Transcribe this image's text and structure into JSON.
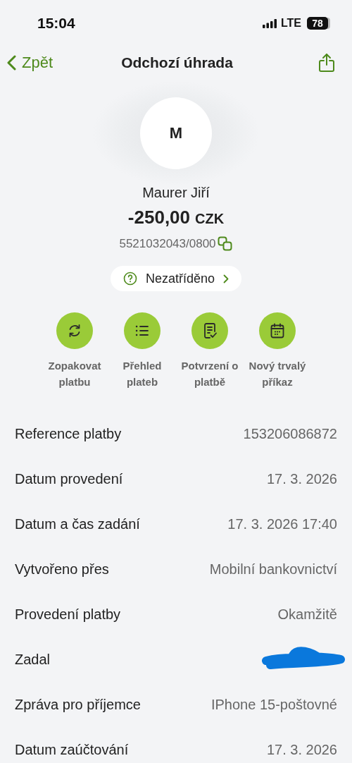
{
  "status_bar": {
    "time": "15:04",
    "network": "LTE",
    "battery": "78"
  },
  "nav": {
    "back": "Zpět",
    "title": "Odchozí úhrada"
  },
  "header": {
    "avatar": "M",
    "name": "Maurer Jiří",
    "amount": "-250,00",
    "currency": "CZK",
    "account": "5521032043/0800",
    "category": "Nezatříděno"
  },
  "actions": [
    {
      "kind": "repeat",
      "label": "Zopakovat platbu"
    },
    {
      "kind": "list",
      "label": "Přehled plateb"
    },
    {
      "kind": "document",
      "label": "Potvrzení o platbě"
    },
    {
      "kind": "calendar",
      "label": "Nový trvalý příkaz"
    }
  ],
  "details": [
    {
      "kind": "text",
      "label": "Reference platby",
      "value": "153206086872"
    },
    {
      "kind": "text",
      "label": "Datum provedení",
      "value": "17. 3. 2026"
    },
    {
      "kind": "text",
      "label": "Datum a čas zadání",
      "value": "17. 3. 2026 17:40"
    },
    {
      "kind": "text",
      "label": "Vytvořeno přes",
      "value": "Mobilní bankovnictví"
    },
    {
      "kind": "text",
      "label": "Provedení platby",
      "value": "Okamžitě"
    },
    {
      "kind": "redacted",
      "label": "Zadal"
    },
    {
      "kind": "text",
      "label": "Zpráva pro příjemce",
      "value": "IPhone 15-poštovné"
    },
    {
      "kind": "text",
      "label": "Datum zaúčtování",
      "value": "17. 3. 2026"
    }
  ]
}
